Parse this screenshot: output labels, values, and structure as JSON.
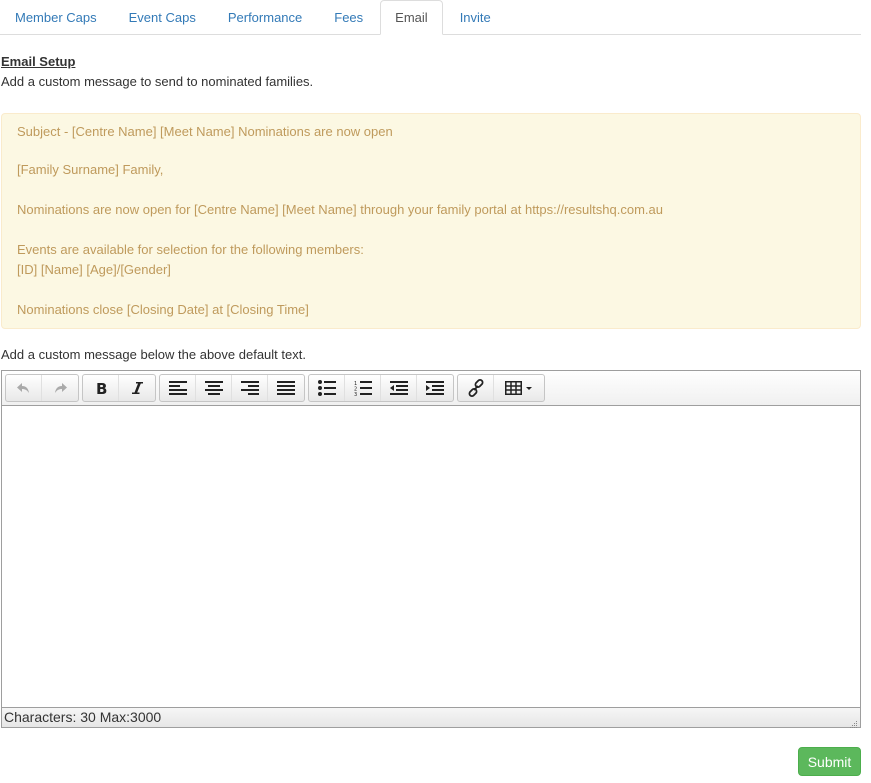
{
  "tabs": [
    {
      "label": "Member Caps",
      "active": false
    },
    {
      "label": "Event Caps",
      "active": false
    },
    {
      "label": "Performance",
      "active": false
    },
    {
      "label": "Fees",
      "active": false
    },
    {
      "label": "Email",
      "active": true
    },
    {
      "label": "Invite",
      "active": false
    }
  ],
  "section": {
    "title": "Email Setup",
    "description": "Add a custom message to send to nominated families."
  },
  "default_template": {
    "subject": "Subject - [Centre Name] [Meet Name] Nominations are now open",
    "greeting": "[Family Surname] Family,",
    "body_line": "Nominations are now open for [Centre Name] [Meet Name] through your family portal at https://resultshq.com.au",
    "events_intro": "Events are available for selection for the following members:",
    "member_line": "[ID] [Name] [Age]/[Gender]",
    "closing": "Nominations close [Closing Date] at [Closing Time]"
  },
  "custom_message": {
    "label": "Add a custom message below the above default text.",
    "content": "",
    "toolbar": {
      "groups": [
        [
          "undo-icon",
          "redo-icon"
        ],
        [
          "bold-icon",
          "italic-icon"
        ],
        [
          "align-left-icon",
          "align-center-icon",
          "align-right-icon",
          "align-justify-icon"
        ],
        [
          "bullet-list-icon",
          "numbered-list-icon",
          "outdent-icon",
          "indent-icon"
        ],
        [
          "link-icon",
          "table-icon"
        ]
      ]
    },
    "status": "Characters: 30 Max:3000"
  },
  "actions": {
    "submit_label": "Submit"
  },
  "colors": {
    "link": "#337ab7",
    "alert_bg": "#fcf8e3",
    "alert_text": "#bf9a5c",
    "submit_bg": "#5cb85c"
  }
}
